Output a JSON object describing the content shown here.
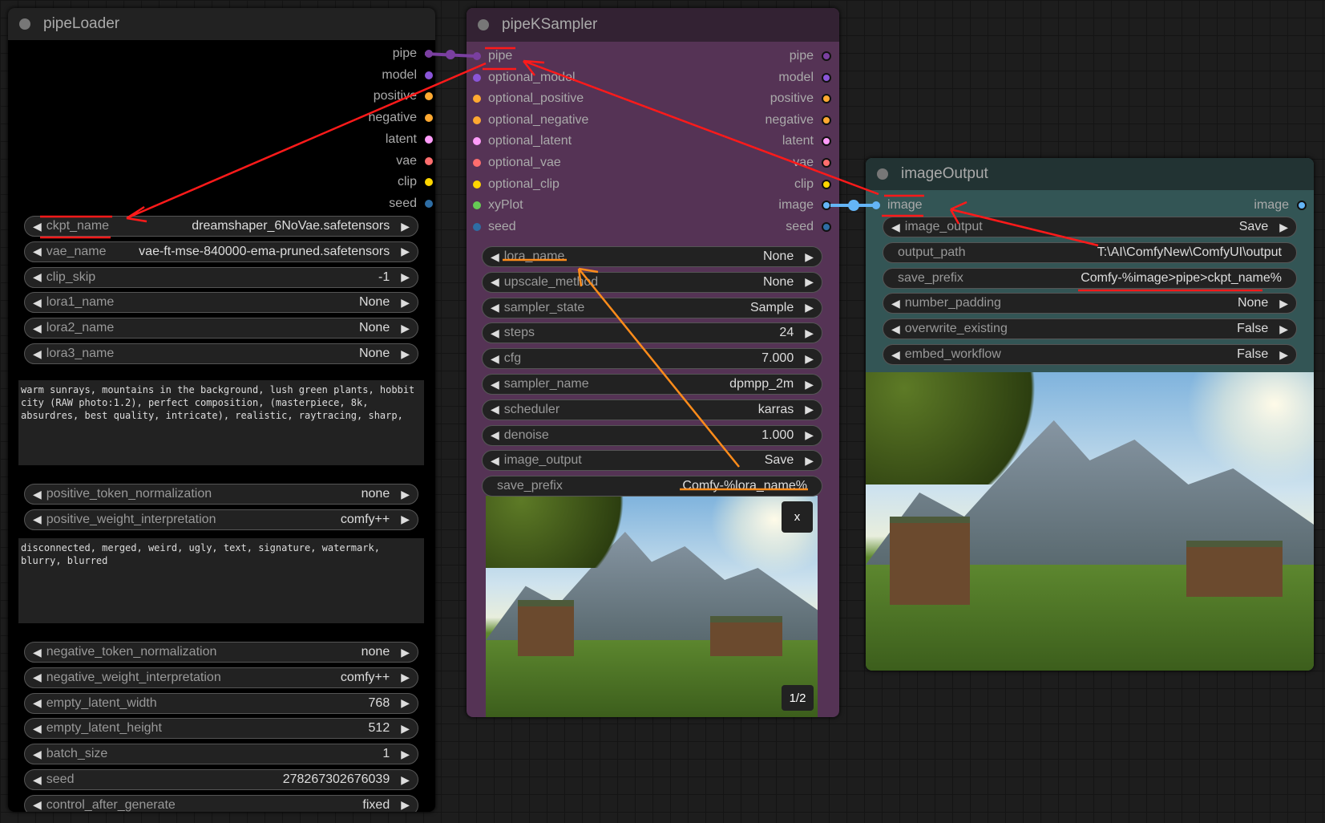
{
  "colors": {
    "pipe": "#7a3fa0",
    "model": "#8a55d8",
    "positive": "#ffa931",
    "negative": "#ffa931",
    "latent": "#ff9cf9",
    "vae": "#ff6e6e",
    "clip": "#ffd500",
    "seed": "#2e6da4",
    "image": "#64b5f6",
    "xyPlot": "#66cc55",
    "annotation_red": "#ff1a1a",
    "annotation_orange": "#ff8c1a"
  },
  "pipeLoader": {
    "title": "pipeLoader",
    "outputs": [
      "pipe",
      "model",
      "positive",
      "negative",
      "latent",
      "vae",
      "clip",
      "seed"
    ],
    "widgets1": [
      {
        "label": "ckpt_name",
        "value": "dreamshaper_6NoVae.safetensors"
      },
      {
        "label": "vae_name",
        "value": "vae-ft-mse-840000-ema-pruned.safetensors"
      },
      {
        "label": "clip_skip",
        "value": "-1"
      },
      {
        "label": "lora1_name",
        "value": "None"
      },
      {
        "label": "lora2_name",
        "value": "None"
      },
      {
        "label": "lora3_name",
        "value": "None"
      }
    ],
    "positive_prompt": "warm sunrays, mountains in the background, lush green plants, hobbit city (RAW photo:1.2), perfect composition, (masterpiece, 8k, absurdres, best quality, intricate), realistic, raytracing, sharp,",
    "widgets2": [
      {
        "label": "positive_token_normalization",
        "value": "none"
      },
      {
        "label": "positive_weight_interpretation",
        "value": "comfy++"
      }
    ],
    "negative_prompt": "disconnected, merged, weird, ugly, text, signature, watermark, blurry, blurred",
    "widgets3": [
      {
        "label": "negative_token_normalization",
        "value": "none"
      },
      {
        "label": "negative_weight_interpretation",
        "value": "comfy++"
      },
      {
        "label": "empty_latent_width",
        "value": "768"
      },
      {
        "label": "empty_latent_height",
        "value": "512"
      },
      {
        "label": "batch_size",
        "value": "1"
      },
      {
        "label": "seed",
        "value": "278267302676039"
      },
      {
        "label": "control_after_generate",
        "value": "fixed"
      }
    ]
  },
  "pipeKSampler": {
    "title": "pipeKSampler",
    "inputs": [
      {
        "label": "pipe",
        "type": "pipe"
      },
      {
        "label": "optional_model",
        "type": "model"
      },
      {
        "label": "optional_positive",
        "type": "positive"
      },
      {
        "label": "optional_negative",
        "type": "negative"
      },
      {
        "label": "optional_latent",
        "type": "latent"
      },
      {
        "label": "optional_vae",
        "type": "vae"
      },
      {
        "label": "optional_clip",
        "type": "clip"
      },
      {
        "label": "xyPlot",
        "type": "xyPlot"
      },
      {
        "label": "seed",
        "type": "seed"
      }
    ],
    "outputs": [
      {
        "label": "pipe",
        "type": "pipe"
      },
      {
        "label": "model",
        "type": "model"
      },
      {
        "label": "positive",
        "type": "positive"
      },
      {
        "label": "negative",
        "type": "negative"
      },
      {
        "label": "latent",
        "type": "latent"
      },
      {
        "label": "vae",
        "type": "vae"
      },
      {
        "label": "clip",
        "type": "clip"
      },
      {
        "label": "image",
        "type": "image"
      },
      {
        "label": "seed",
        "type": "seed"
      }
    ],
    "widgets": [
      {
        "label": "lora_name",
        "value": "None"
      },
      {
        "label": "upscale_method",
        "value": "None"
      },
      {
        "label": "sampler_state",
        "value": "Sample"
      },
      {
        "label": "steps",
        "value": "24"
      },
      {
        "label": "cfg",
        "value": "7.000"
      },
      {
        "label": "sampler_name",
        "value": "dpmpp_2m"
      },
      {
        "label": "scheduler",
        "value": "karras"
      },
      {
        "label": "denoise",
        "value": "1.000"
      },
      {
        "label": "image_output",
        "value": "Save"
      }
    ],
    "save_prefix": {
      "label": "save_prefix",
      "value": "Comfy-%lora_name%"
    },
    "preview": {
      "close_label": "x",
      "counter": "1/2"
    }
  },
  "imageOutput": {
    "title": "imageOutput",
    "input": "image",
    "output": "image",
    "widgets": [
      {
        "label": "image_output",
        "value": "Save",
        "arrows": true
      },
      {
        "label": "output_path",
        "value": "T:\\AI\\ComfyNew\\ComfyUI\\output",
        "arrows": false
      },
      {
        "label": "save_prefix",
        "value": "Comfy-%image>pipe>ckpt_name%",
        "arrows": false
      },
      {
        "label": "number_padding",
        "value": "None",
        "arrows": true
      },
      {
        "label": "overwrite_existing",
        "value": "False",
        "arrows": true
      },
      {
        "label": "embed_workflow",
        "value": "False",
        "arrows": true
      }
    ]
  }
}
